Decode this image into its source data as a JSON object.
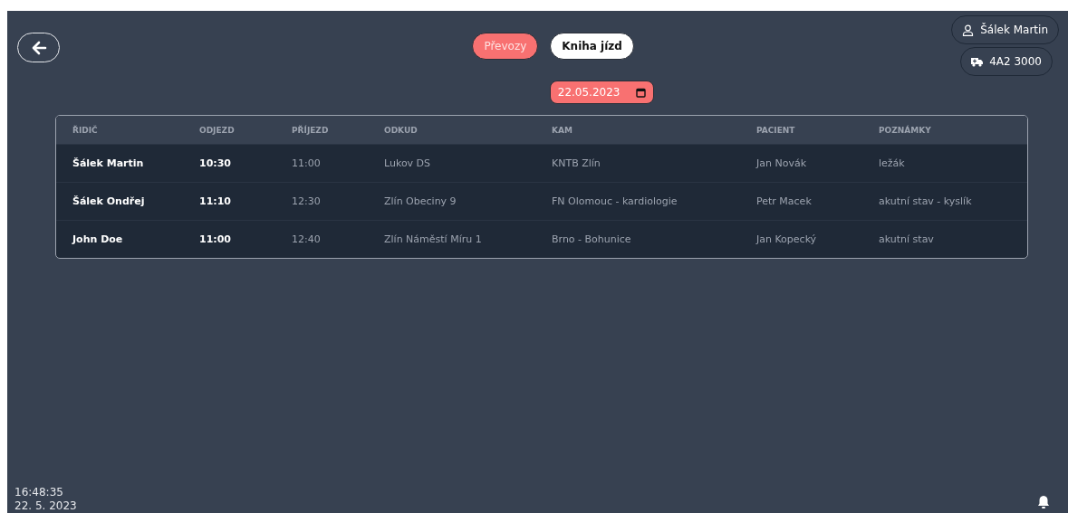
{
  "tabs": [
    {
      "label": "Převozy",
      "selected": false
    },
    {
      "label": "Kniha jízd",
      "selected": true
    }
  ],
  "date_field": {
    "value": "22.05.2023"
  },
  "user": {
    "name": "Šálek Martin",
    "vehicle": "4A2 3000"
  },
  "table": {
    "columns": [
      "ŘIDIČ",
      "ODJEZD",
      "PŘÍJEZD",
      "ODKUD",
      "KAM",
      "PACIENT",
      "POZNÁMKY"
    ],
    "rows": [
      [
        "Šálek Martin",
        "10:30",
        "11:00",
        "Lukov DS",
        "KNTB Zlín",
        "Jan Novák",
        "ležák"
      ],
      [
        "Šálek Ondřej",
        "11:10",
        "12:30",
        "Zlín Obeciny 9",
        "FN Olomouc - kardiologie",
        "Petr Macek",
        "akutní stav - kyslík"
      ],
      [
        "John Doe",
        "11:00",
        "12:40",
        "Zlín Náměstí Míru 1",
        "Brno - Bohunice",
        "Jan Kopecký",
        "akutní stav"
      ]
    ]
  },
  "clock": {
    "time": "16:48:35",
    "date": "22. 5. 2023"
  }
}
